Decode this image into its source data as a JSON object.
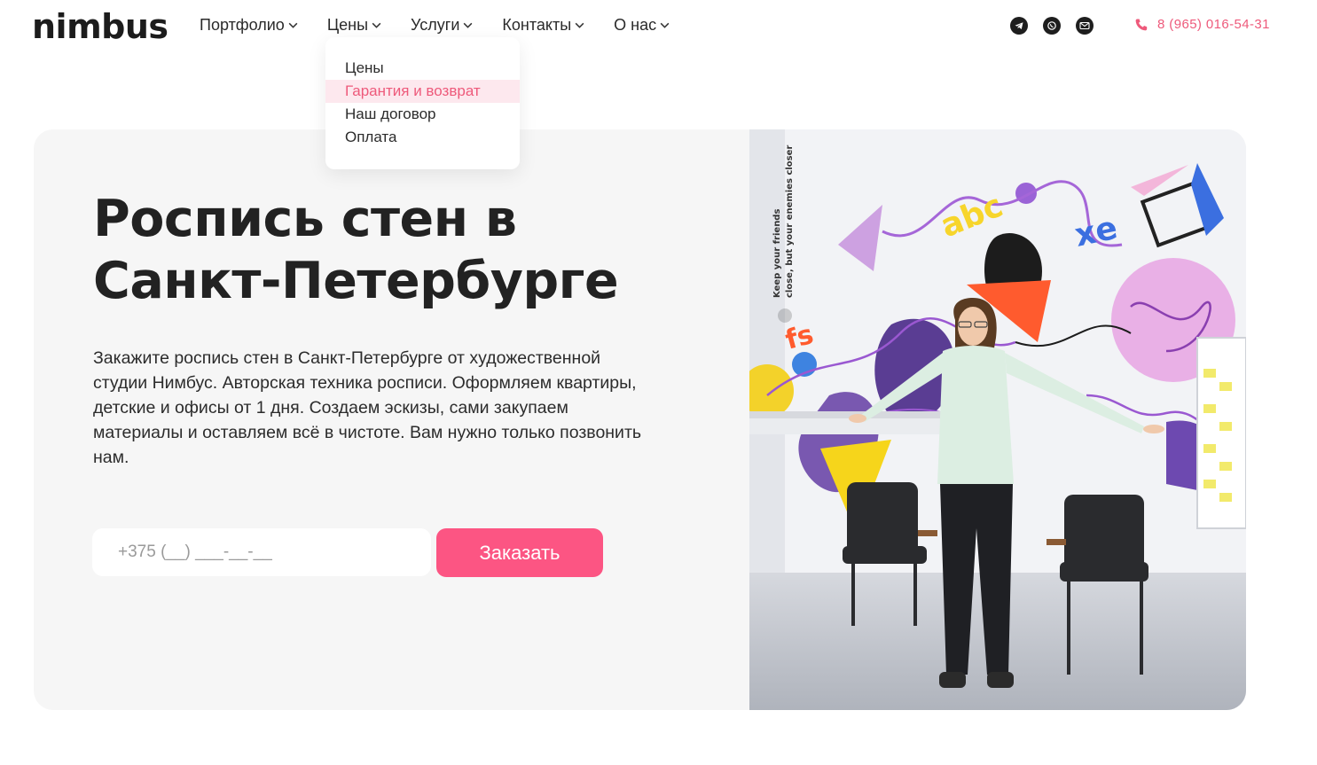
{
  "header": {
    "logo": "nimbus",
    "nav": [
      {
        "label": "Портфолио"
      },
      {
        "label": "Цены"
      },
      {
        "label": "Услуги"
      },
      {
        "label": "Контакты"
      },
      {
        "label": "О нас"
      }
    ],
    "social_icons": [
      "telegram-icon",
      "whatsapp-icon",
      "email-icon"
    ],
    "phone": "8 (965) 016-54-31"
  },
  "dropdown": {
    "items": [
      {
        "label": "Цены"
      },
      {
        "label": "Гарантия и возврат"
      },
      {
        "label": "Наш договор"
      },
      {
        "label": "Оплата"
      }
    ],
    "highlighted_index": 1
  },
  "hero": {
    "title_line1": "Роспись стен в",
    "title_line2": "Санкт-Петербурге",
    "description": "Закажите роспись стен в Санкт-Петербурге от художественной студии Нимбус. Авторская техника росписи. Оформляем квартиры, детские и офисы от 1 дня. Создаем эскизы, сами закупаем материалы и оставляем всё в чистоте. Вам нужно только позвонить нам.",
    "phone_placeholder": "+375 (__) ___-__-__",
    "order_button": "Заказать"
  },
  "photo": {
    "wall_text_1": "Keep your friends",
    "wall_text_2": "close, but your enemies closer",
    "mural_abc": "abc",
    "mural_xe": "xe",
    "mural_fs": "fs"
  },
  "colors": {
    "accent": "#fc5583",
    "accent_text": "#ee5a7b",
    "hero_bg": "#f6f6f6",
    "dropdown_highlight": "#fde8ee"
  }
}
